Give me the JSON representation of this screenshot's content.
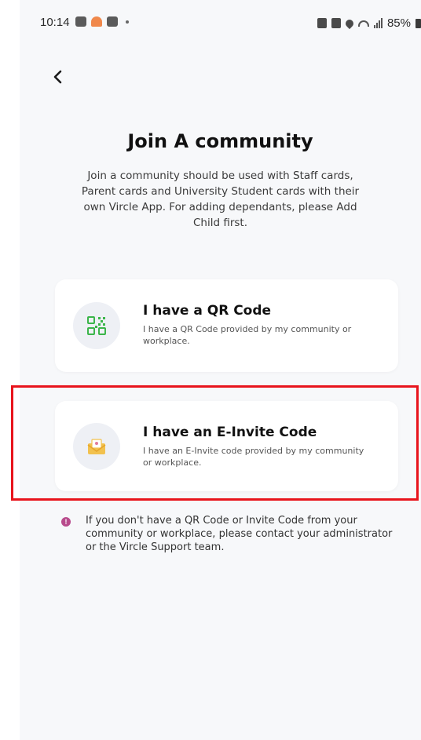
{
  "status_bar": {
    "time": "10:14",
    "battery": "85%"
  },
  "header": {
    "title": "Join A community",
    "description": "Join a community should be used with Staff cards, Parent cards and University Student cards with their own Vircle App. For adding dependants, please Add Child first."
  },
  "options": [
    {
      "title": "I have a QR Code",
      "description": "I have a QR Code provided by my community or workplace.",
      "icon": "qr-code-icon"
    },
    {
      "title": "I have an E-Invite Code",
      "description": "I have an E-Invite code provided by my community or workplace.",
      "icon": "envelope-icon"
    }
  ],
  "info": {
    "text": "If you don't have a QR Code or Invite Code from your community or workplace, please contact your administrator or the Vircle Support team."
  },
  "colors": {
    "background": "#f7f8fa",
    "card": "#ffffff",
    "qr_icon": "#3bb54a",
    "envelope_icon": "#f2c14e",
    "info_icon": "#b84b8c",
    "highlight": "#e8141c"
  }
}
